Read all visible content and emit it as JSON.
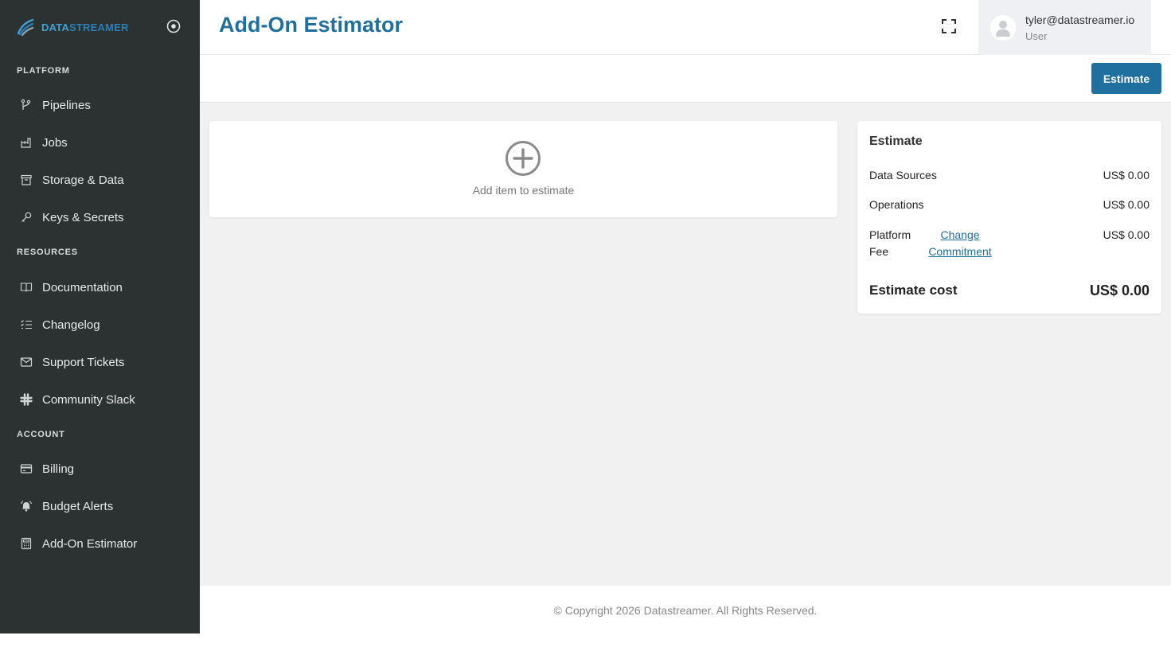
{
  "brand": {
    "part1": "DATA",
    "part2": "STREAMER",
    "color_primary": "#3ea3d9",
    "color_secondary": "#2a7fb8"
  },
  "sidebar": {
    "sections": [
      {
        "label": "PLATFORM",
        "items": [
          {
            "label": "Pipelines",
            "icon": "branch-icon"
          },
          {
            "label": "Jobs",
            "icon": "factory-icon"
          },
          {
            "label": "Storage & Data",
            "icon": "archive-icon"
          },
          {
            "label": "Keys & Secrets",
            "icon": "key-icon"
          }
        ]
      },
      {
        "label": "RESOURCES",
        "items": [
          {
            "label": "Documentation",
            "icon": "book-icon"
          },
          {
            "label": "Changelog",
            "icon": "list-check-icon"
          },
          {
            "label": "Support Tickets",
            "icon": "envelope-icon"
          },
          {
            "label": "Community Slack",
            "icon": "slack-icon"
          }
        ]
      },
      {
        "label": "ACCOUNT",
        "items": [
          {
            "label": "Billing",
            "icon": "credit-card-icon"
          },
          {
            "label": "Budget Alerts",
            "icon": "bell-icon"
          },
          {
            "label": "Add-On Estimator",
            "icon": "calculator-icon"
          }
        ]
      }
    ],
    "background": "#2c3131"
  },
  "header": {
    "title": "Add-On Estimator",
    "user_email": "tyler@datastreamer.io",
    "user_role": "User",
    "accent": "#1f6f9f"
  },
  "toolbar": {
    "estimate_label": "Estimate"
  },
  "add_item": {
    "label": "Add item to estimate"
  },
  "estimate": {
    "title": "Estimate",
    "data_sources_label": "Data Sources",
    "data_sources_value": "US$ 0.00",
    "operations_label": "Operations",
    "operations_value": "US$ 0.00",
    "platform_label_line1": "Platform",
    "platform_label_line2": "Fee",
    "change_link_line1": "Change",
    "change_link_line2": "Commitment",
    "platform_value": "US$ 0.00",
    "total_label": "Estimate cost",
    "total_value": "US$ 0.00"
  },
  "footer": {
    "copyright": "© Copyright 2026 Datastreamer. All Rights Reserved."
  }
}
